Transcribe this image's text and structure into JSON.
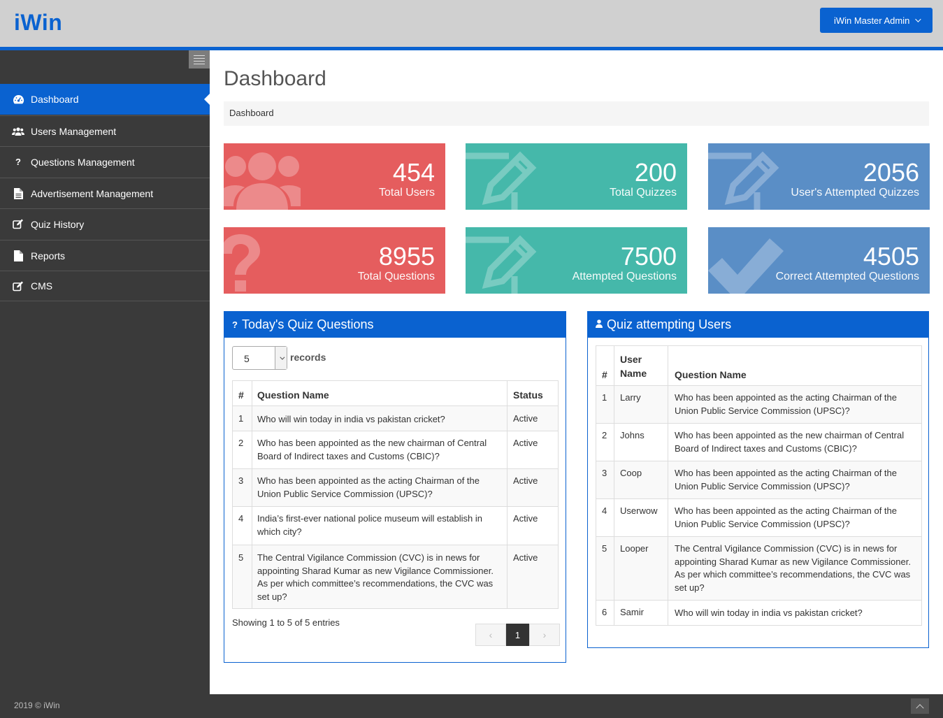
{
  "app": {
    "logo": "iWin",
    "admin_label": "iWin Master Admin"
  },
  "sidebar": {
    "items": [
      {
        "label": "Dashboard",
        "icon": "dashboard-icon",
        "active": true
      },
      {
        "label": "Users Management",
        "icon": "users-icon"
      },
      {
        "label": "Questions Management",
        "icon": "question-icon"
      },
      {
        "label": "Advertisement Management",
        "icon": "file-icon"
      },
      {
        "label": "Quiz History",
        "icon": "edit-icon"
      },
      {
        "label": "Reports",
        "icon": "file-icon"
      },
      {
        "label": "CMS",
        "icon": "edit-icon"
      }
    ]
  },
  "page": {
    "title": "Dashboard",
    "breadcrumb": "Dashboard"
  },
  "stats": [
    {
      "value": "454",
      "label": "Total Users",
      "color": "#e55d5e",
      "icon": "users-icon"
    },
    {
      "value": "200",
      "label": "Total Quizzes",
      "color": "#45b8aa",
      "icon": "pencil-icon"
    },
    {
      "value": "2056",
      "label": "User's Attempted Quizzes",
      "color": "#5a8ec6",
      "icon": "pencil-icon"
    },
    {
      "value": "8955",
      "label": "Total Questions",
      "color": "#e55d5e",
      "icon": "question-icon"
    },
    {
      "value": "7500",
      "label": "Attempted Questions",
      "color": "#45b8aa",
      "icon": "pencil-icon"
    },
    {
      "value": "4505",
      "label": "Correct Attempted Questions",
      "color": "#5a8ec6",
      "icon": "check-icon"
    }
  ],
  "quiz_panel": {
    "title": "Today's Quiz Questions",
    "records_value": "5",
    "records_label": "records",
    "columns": [
      "#",
      "Question Name",
      "Status"
    ],
    "rows": [
      [
        "1",
        "Who will win today in india vs pakistan cricket?",
        "Active"
      ],
      [
        "2",
        "Who has been appointed as the new chairman of Central Board of Indirect taxes and Customs (CBIC)?",
        "Active"
      ],
      [
        "3",
        "Who has been appointed as the acting Chairman of the Union Public Service Commission (UPSC)?",
        "Active"
      ],
      [
        "4",
        "India’s first-ever national police museum will establish in which city?",
        "Active"
      ],
      [
        "5",
        "The Central Vigilance Commission (CVC) is in news for appointing Sharad Kumar as new Vigilance Commissioner. As per which committee’s recommendations, the CVC was set up?",
        "Active"
      ]
    ],
    "showing": "Showing 1 to 5 of 5 entries",
    "pager": {
      "prev": "‹",
      "current": "1",
      "next": "›"
    }
  },
  "users_panel": {
    "title": "Quiz attempting Users",
    "columns": [
      "#",
      "User Name",
      "Question Name"
    ],
    "rows": [
      [
        "1",
        "Larry",
        "Who has been appointed as the acting Chairman of the Union Public Service Commission (UPSC)?"
      ],
      [
        "2",
        "Johns",
        "Who has been appointed as the new chairman of Central Board of Indirect taxes and Customs (CBIC)?"
      ],
      [
        "3",
        "Coop",
        "Who has been appointed as the acting Chairman of the Union Public Service Commission (UPSC)?"
      ],
      [
        "4",
        "Userwow",
        "Who has been appointed as the acting Chairman of the Union Public Service Commission (UPSC)?"
      ],
      [
        "5",
        "Looper",
        "The Central Vigilance Commission (CVC) is in news for appointing Sharad Kumar as new Vigilance Commissioner. As per which committee’s recommendations, the CVC was set up?"
      ],
      [
        "6",
        "Samir",
        "Who will win today in india vs pakistan cricket?"
      ]
    ]
  },
  "footer": {
    "text": "2019 © iWin"
  }
}
